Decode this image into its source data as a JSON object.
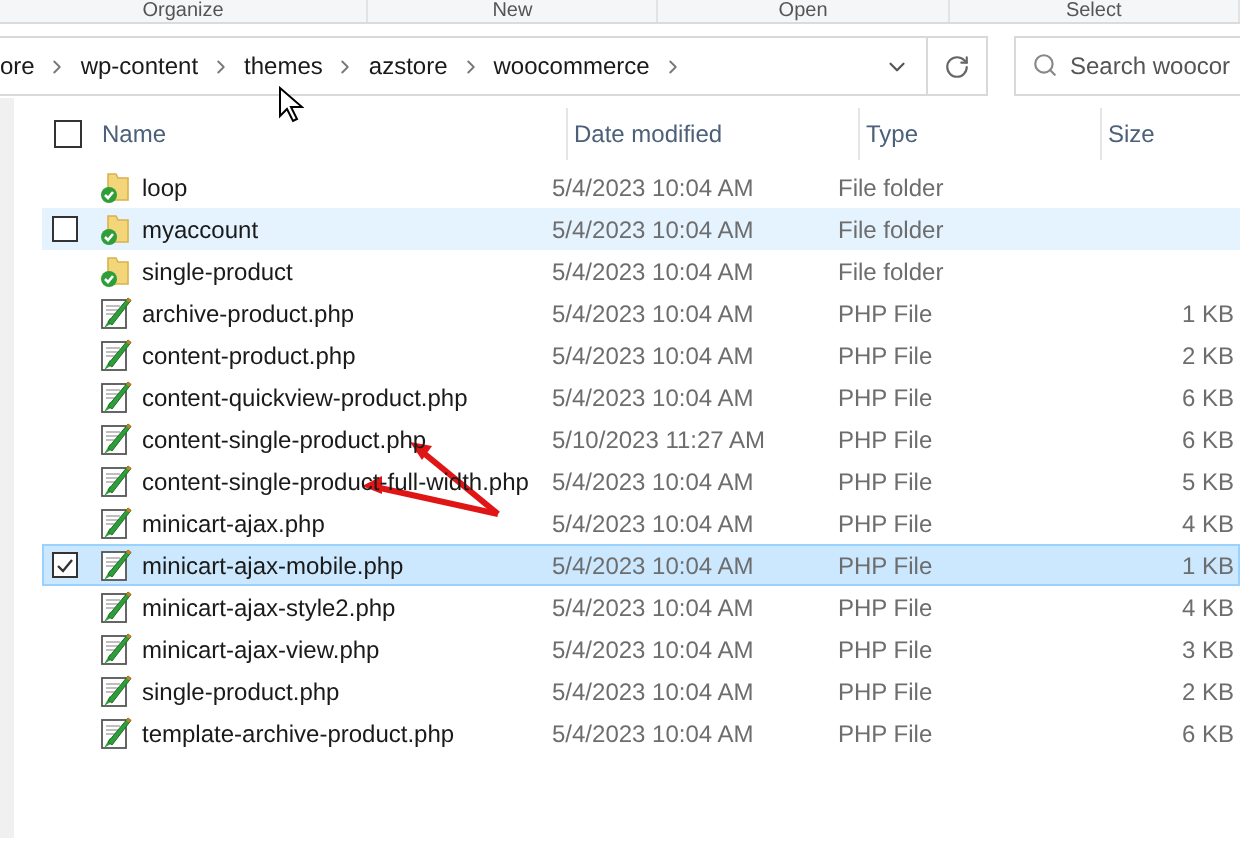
{
  "ribbon_groups": [
    "Organize",
    "New",
    "Open",
    "Select"
  ],
  "address_bar": {
    "path": [
      "ore",
      "wp-content",
      "themes",
      "azstore",
      "woocommerce"
    ]
  },
  "search": {
    "placeholder": "Search woocor"
  },
  "columns": [
    "Name",
    "Date modified",
    "Type",
    "Size"
  ],
  "select_all": {
    "checked": false
  },
  "rows": [
    {
      "kind": "folder",
      "name": "loop",
      "date": "5/4/2023 10:04 AM",
      "type": "File folder",
      "hovered": false,
      "selected": false
    },
    {
      "kind": "folder",
      "name": "myaccount",
      "date": "5/4/2023 10:04 AM",
      "type": "File folder",
      "hovered": true,
      "selected": false
    },
    {
      "kind": "folder",
      "name": "single-product",
      "date": "5/4/2023 10:04 AM",
      "type": "File folder",
      "hovered": false,
      "selected": false
    },
    {
      "kind": "php",
      "name": "archive-product.php",
      "date": "5/4/2023 10:04 AM",
      "type": "PHP File",
      "size": "1 KB",
      "hovered": false,
      "selected": false
    },
    {
      "kind": "php",
      "name": "content-product.php",
      "date": "5/4/2023 10:04 AM",
      "type": "PHP File",
      "size": "2 KB",
      "hovered": false,
      "selected": false
    },
    {
      "kind": "php",
      "name": "content-quickview-product.php",
      "date": "5/4/2023 10:04 AM",
      "type": "PHP File",
      "size": "6 KB",
      "hovered": false,
      "selected": false
    },
    {
      "kind": "php",
      "name": "content-single-product.php",
      "date": "5/10/2023 11:27 AM",
      "type": "PHP File",
      "size": "6 KB",
      "hovered": false,
      "selected": false
    },
    {
      "kind": "php",
      "name": "content-single-product-full-width.php",
      "date": "5/4/2023 10:04 AM",
      "type": "PHP File",
      "size": "5 KB",
      "hovered": false,
      "selected": false
    },
    {
      "kind": "php",
      "name": "minicart-ajax.php",
      "date": "5/4/2023 10:04 AM",
      "type": "PHP File",
      "size": "4 KB",
      "hovered": false,
      "selected": false
    },
    {
      "kind": "php",
      "name": "minicart-ajax-mobile.php",
      "date": "5/4/2023 10:04 AM",
      "type": "PHP File",
      "size": "1 KB",
      "hovered": false,
      "selected": true
    },
    {
      "kind": "php",
      "name": "minicart-ajax-style2.php",
      "date": "5/4/2023 10:04 AM",
      "type": "PHP File",
      "size": "4 KB",
      "hovered": false,
      "selected": false
    },
    {
      "kind": "php",
      "name": "minicart-ajax-view.php",
      "date": "5/4/2023 10:04 AM",
      "type": "PHP File",
      "size": "3 KB",
      "hovered": false,
      "selected": false
    },
    {
      "kind": "php",
      "name": "single-product.php",
      "date": "5/4/2023 10:04 AM",
      "type": "PHP File",
      "size": "2 KB",
      "hovered": false,
      "selected": false
    },
    {
      "kind": "php",
      "name": "template-archive-product.php",
      "date": "5/4/2023 10:04 AM",
      "type": "PHP File",
      "size": "6 KB",
      "hovered": false,
      "selected": false
    }
  ]
}
